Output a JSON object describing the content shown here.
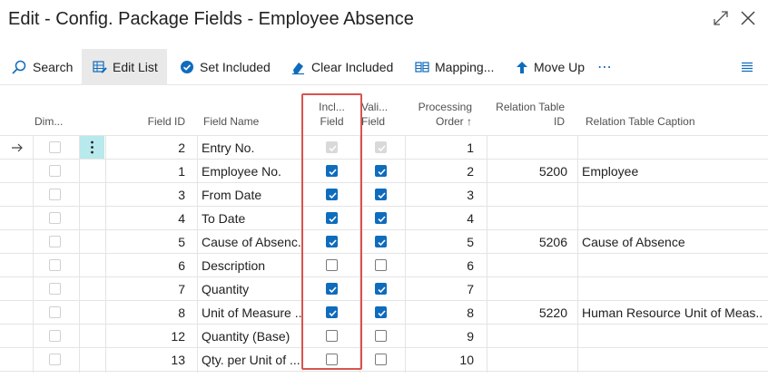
{
  "window": {
    "title": "Edit - Config. Package Fields - Employee Absence"
  },
  "toolbar": {
    "search": "Search",
    "edit_list": "Edit List",
    "set_included": "Set Included",
    "clear_included": "Clear Included",
    "mapping": "Mapping...",
    "move_up": "Move Up",
    "more": "⋯"
  },
  "columns": {
    "dim": "Dim...",
    "field_id": "Field ID",
    "field_name": "Field Name",
    "incl_1": "Incl...",
    "incl_2": "Field",
    "vali_1": "Vali...",
    "vali_2": "Field",
    "proc_1": "Processing",
    "proc_2": "Order ↑",
    "rel_1": "Relation Table",
    "rel_2": "ID",
    "rel_caption": "Relation Table Caption"
  },
  "rows": [
    {
      "field_id": "2",
      "field_name": "Entry No.",
      "included": true,
      "validate": true,
      "order": "1",
      "rel_id": "",
      "rel_caption": "",
      "disabled": true,
      "current": true
    },
    {
      "field_id": "1",
      "field_name": "Employee No.",
      "included": true,
      "validate": true,
      "order": "2",
      "rel_id": "5200",
      "rel_caption": "Employee"
    },
    {
      "field_id": "3",
      "field_name": "From Date",
      "included": true,
      "validate": true,
      "order": "3",
      "rel_id": "",
      "rel_caption": ""
    },
    {
      "field_id": "4",
      "field_name": "To Date",
      "included": true,
      "validate": true,
      "order": "4",
      "rel_id": "",
      "rel_caption": ""
    },
    {
      "field_id": "5",
      "field_name": "Cause of Absenc...",
      "included": true,
      "validate": true,
      "order": "5",
      "rel_id": "5206",
      "rel_caption": "Cause of Absence"
    },
    {
      "field_id": "6",
      "field_name": "Description",
      "included": false,
      "validate": false,
      "order": "6",
      "rel_id": "",
      "rel_caption": ""
    },
    {
      "field_id": "7",
      "field_name": "Quantity",
      "included": true,
      "validate": true,
      "order": "7",
      "rel_id": "",
      "rel_caption": ""
    },
    {
      "field_id": "8",
      "field_name": "Unit of Measure ...",
      "included": true,
      "validate": true,
      "order": "8",
      "rel_id": "5220",
      "rel_caption": "Human Resource Unit of Meas..."
    },
    {
      "field_id": "12",
      "field_name": "Quantity (Base)",
      "included": false,
      "validate": false,
      "order": "9",
      "rel_id": "",
      "rel_caption": ""
    },
    {
      "field_id": "13",
      "field_name": "Qty. per Unit of ...",
      "included": false,
      "validate": false,
      "order": "10",
      "rel_id": "",
      "rel_caption": ""
    }
  ],
  "colors": {
    "accent": "#0f6cbd",
    "highlight_box": "#d9534f",
    "row_menu": "#b8e9ec"
  }
}
